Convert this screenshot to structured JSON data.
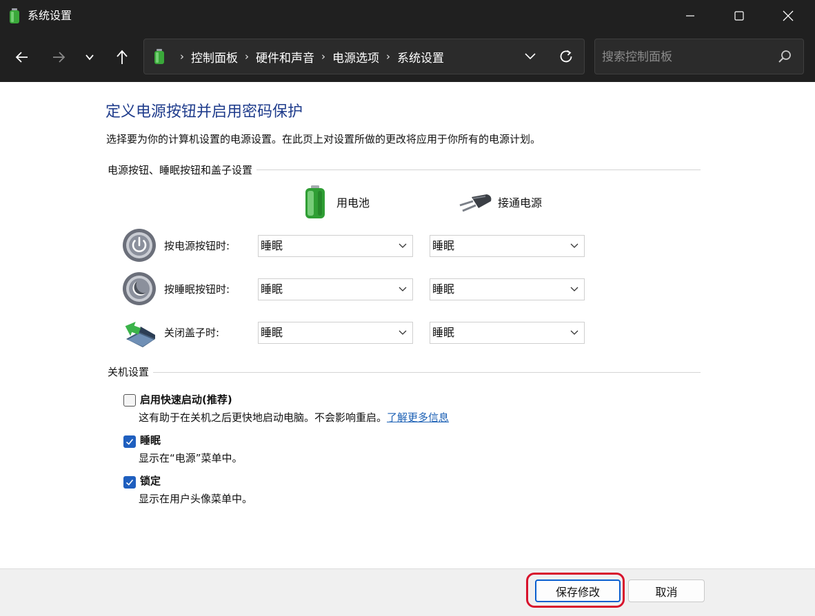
{
  "window": {
    "title": "系统设置"
  },
  "nav": {
    "breadcrumbs": [
      "控制面板",
      "硬件和声音",
      "电源选项",
      "系统设置"
    ],
    "search_placeholder": "搜索控制面板"
  },
  "page": {
    "heading": "定义电源按钮并启用密码保护",
    "description": "选择要为你的计算机设置的电源设置。在此页上对设置所做的更改将应用于你所有的电源计划。",
    "section_buttons": "电源按钮、睡眠按钮和盖子设置",
    "column_battery": "用电池",
    "column_plugged": "接通电源",
    "rows": [
      {
        "label": "按电源按钮时:",
        "battery": "睡眠",
        "plugged": "睡眠",
        "icon": "power-button-icon"
      },
      {
        "label": "按睡眠按钮时:",
        "battery": "睡眠",
        "plugged": "睡眠",
        "icon": "sleep-button-icon"
      },
      {
        "label": "关闭盖子时:",
        "battery": "睡眠",
        "plugged": "睡眠",
        "icon": "laptop-lid-icon"
      }
    ],
    "section_shutdown": "关机设置",
    "options": [
      {
        "label": "启用快速启动(推荐)",
        "description": "这有助于在关机之后更快地启动电脑。不会影响重启。",
        "link": "了解更多信息",
        "checked": false
      },
      {
        "label": "睡眠",
        "description": "显示在“电源”菜单中。",
        "checked": true
      },
      {
        "label": "锁定",
        "description": "显示在用户头像菜单中。",
        "checked": true
      }
    ]
  },
  "footer": {
    "save_label": "保存修改",
    "cancel_label": "取消"
  },
  "colors": {
    "titlebar": "#202020",
    "heading": "#1f3c8c",
    "link": "#1a5fb4",
    "checkbox_on": "#1f5fbf",
    "highlight": "#d8122c"
  }
}
